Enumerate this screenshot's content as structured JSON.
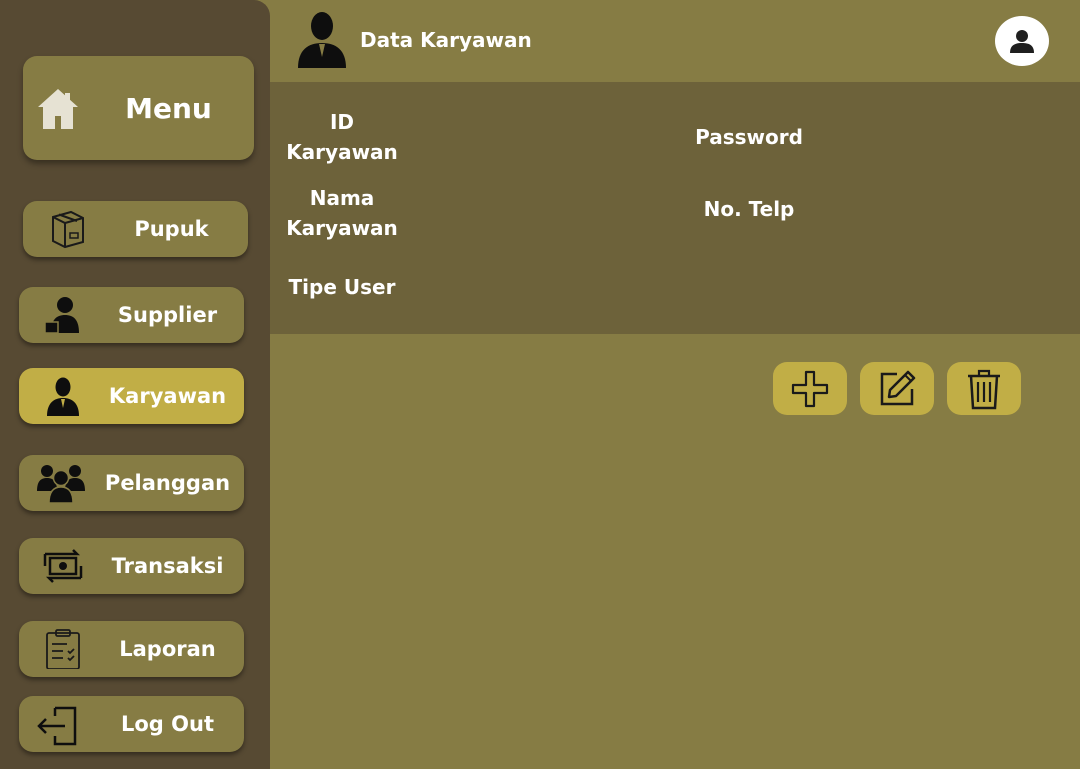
{
  "sidebar": {
    "menu_label": "Menu",
    "items": [
      {
        "label": "Pupuk",
        "icon": "package-box-icon"
      },
      {
        "label": "Supplier",
        "icon": "supplier-person-icon"
      },
      {
        "label": "Karyawan",
        "icon": "employee-icon",
        "active": true
      },
      {
        "label": "Pelanggan",
        "icon": "group-icon"
      },
      {
        "label": "Transaksi",
        "icon": "money-exchange-icon"
      },
      {
        "label": "Laporan",
        "icon": "clipboard-checklist-icon"
      },
      {
        "label": "Log Out",
        "icon": "logout-icon"
      }
    ]
  },
  "header": {
    "title": "Data Karyawan"
  },
  "form": {
    "id_label": "ID\nKaryawan",
    "nama_label": "Nama\nKaryawan",
    "tipe_label": "Tipe User",
    "password_label": "Password",
    "telp_label": "No. Telp"
  },
  "colors": {
    "sidebar": "#574a33",
    "main": "#867c44",
    "panel": "#6d623a",
    "accent": "#c1ae46"
  }
}
